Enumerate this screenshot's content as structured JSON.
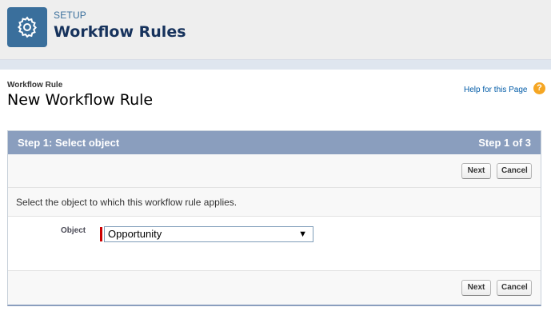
{
  "header": {
    "section_label": "SETUP",
    "title": "Workflow Rules",
    "icon": "gear-icon"
  },
  "page": {
    "type_label": "Workflow Rule",
    "title": "New Workflow Rule",
    "help_link": "Help for this Page",
    "help_icon_glyph": "?"
  },
  "step": {
    "title": "Step 1: Select object",
    "progress": "Step 1 of 3",
    "description": "Select the object to which this workflow rule applies.",
    "buttons": {
      "next": "Next",
      "cancel": "Cancel"
    },
    "object_field": {
      "label": "Object",
      "value": "Opportunity",
      "arrow": "▼"
    }
  },
  "colors": {
    "brand": "#3a6f9c",
    "step_bar": "#8a9ebe",
    "required": "#cc0000",
    "help_icon": "#f5a623"
  }
}
